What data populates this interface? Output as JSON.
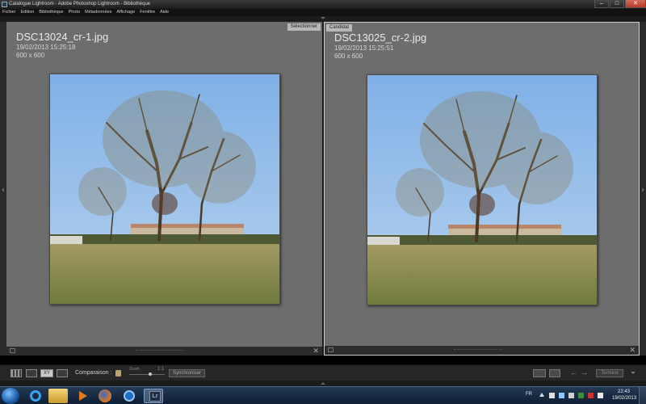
{
  "window": {
    "title": "Catalogue Lightroom - Adobe Photoshop Lightroom - Bibliothèque",
    "minimize_glyph": "–",
    "maximize_glyph": "□",
    "close_glyph": "✕"
  },
  "menu": [
    "Fichier",
    "Edition",
    "Bibliothèque",
    "Photo",
    "Métadonnées",
    "Affichage",
    "Fenêtre",
    "Aide"
  ],
  "compare": {
    "left": {
      "tag": "Sélectionner",
      "filename": "DSC13024_cr-1.jpg",
      "datetime": "19/02/2013 15:25:18",
      "dimensions": "600 x 600"
    },
    "right": {
      "tag": "Candidat",
      "filename": "DSC13025_cr-2.jpg",
      "datetime": "19/02/2013 15:25:51",
      "dimensions": "600 x 600"
    },
    "footer_close_glyph": "✕"
  },
  "toolbar": {
    "compare_view_glyph": "XY",
    "comparison_label": "Comparaison :",
    "zoom_label": "Zoom",
    "stepper_glyph": "1:1",
    "sync_label": "Synchroniser",
    "prev_glyph": "←",
    "next_glyph": "→",
    "done_label": "Terminé"
  },
  "taskbar": {
    "lightroom_label": "Lr",
    "language": "FR",
    "time": "22:43",
    "date": "19/02/2013"
  },
  "colors": {
    "pane_bg": "#6d6d6d",
    "sky": "#8fb8e6",
    "grass": "#8f8a4c",
    "taskbar": "#1a3050"
  }
}
